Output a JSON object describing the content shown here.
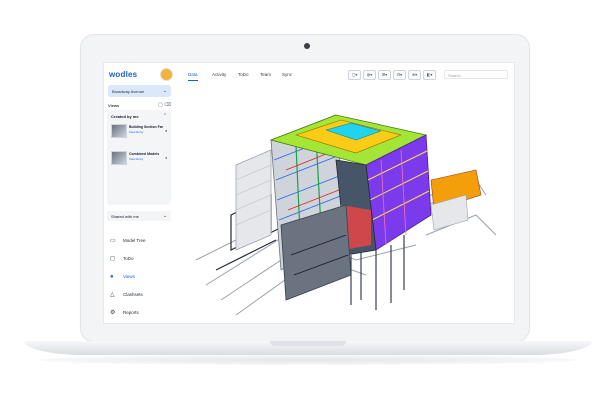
{
  "app": {
    "logo": "wodles"
  },
  "sidebar": {
    "project_name": "Broadway Avenue",
    "views_heading": "Views",
    "views_actions": "▢ ⌫",
    "created_by_me": "Created by me",
    "items": [
      {
        "title": "Building Section Far",
        "subtitle": "View Entry"
      },
      {
        "title": "Combined Models",
        "subtitle": "View Entry"
      }
    ],
    "shared_with_me": "Shared with me",
    "nav": [
      {
        "label": "Model Tree",
        "icon": "folder-icon"
      },
      {
        "label": "ToDo",
        "icon": "todo-icon"
      },
      {
        "label": "Views",
        "icon": "views-icon"
      },
      {
        "label": "Clashsets",
        "icon": "warning-icon"
      },
      {
        "label": "Reports",
        "icon": "gear-icon"
      }
    ]
  },
  "header": {
    "tabs": [
      "Data",
      "Activity",
      "ToDo",
      "Team",
      "Sync"
    ],
    "active_tab": "Data",
    "tools": [
      "▢▾",
      "◍▾",
      "⊞▾",
      "⊟▾",
      "⊕▾",
      "◧▾"
    ],
    "search_placeholder": "Search"
  },
  "colors": {
    "accent": "#1a5fd1",
    "sidebar_panel": "#f4f5f7",
    "project_bg": "#dbe7fb"
  }
}
